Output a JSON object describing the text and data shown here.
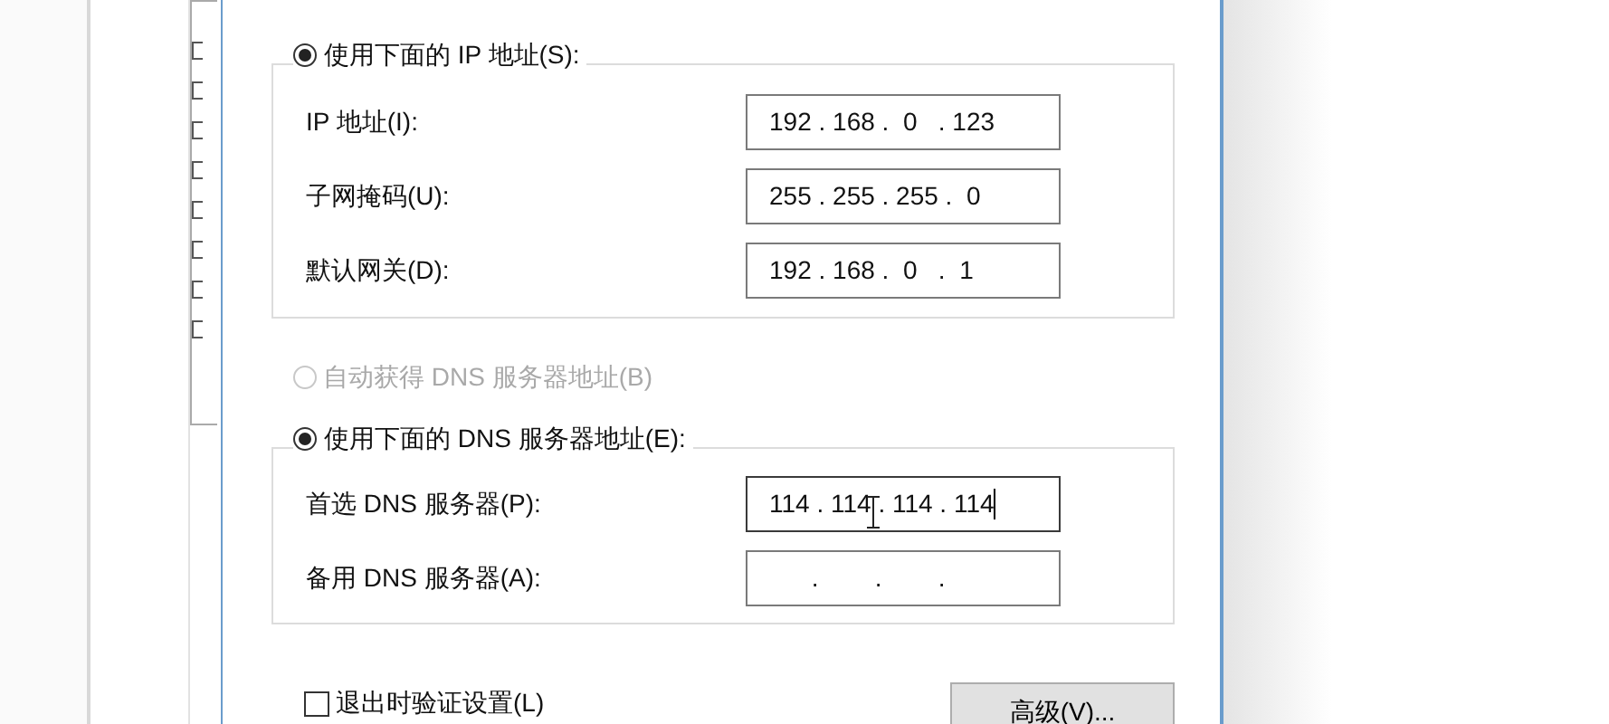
{
  "ip_group": {
    "option": {
      "label": "使用下面的 IP 地址(S):",
      "selected": true
    },
    "fields": [
      {
        "label": "IP 地址(I):",
        "value": "192 . 168 .  0   . 123",
        "focused": false
      },
      {
        "label": "子网掩码(U):",
        "value": "255 . 255 . 255 .  0",
        "focused": false
      },
      {
        "label": "默认网关(D):",
        "value": "192 . 168 .  0   .  1",
        "focused": false
      }
    ]
  },
  "dns_auto": {
    "label": "自动获得 DNS 服务器地址(B)",
    "selected": false,
    "disabled": true
  },
  "dns_group": {
    "option": {
      "label": "使用下面的 DNS 服务器地址(E):",
      "selected": true
    },
    "fields": [
      {
        "label": "首选 DNS 服务器(P):",
        "value": "114 . 114 . 114 . 114",
        "focused": true
      },
      {
        "label": "备用 DNS 服务器(A):",
        "value": "      .        .        .",
        "focused": false
      }
    ]
  },
  "validate": {
    "label": "退出时验证设置(L)",
    "checked": false
  },
  "advanced_button": "高级(V)..."
}
